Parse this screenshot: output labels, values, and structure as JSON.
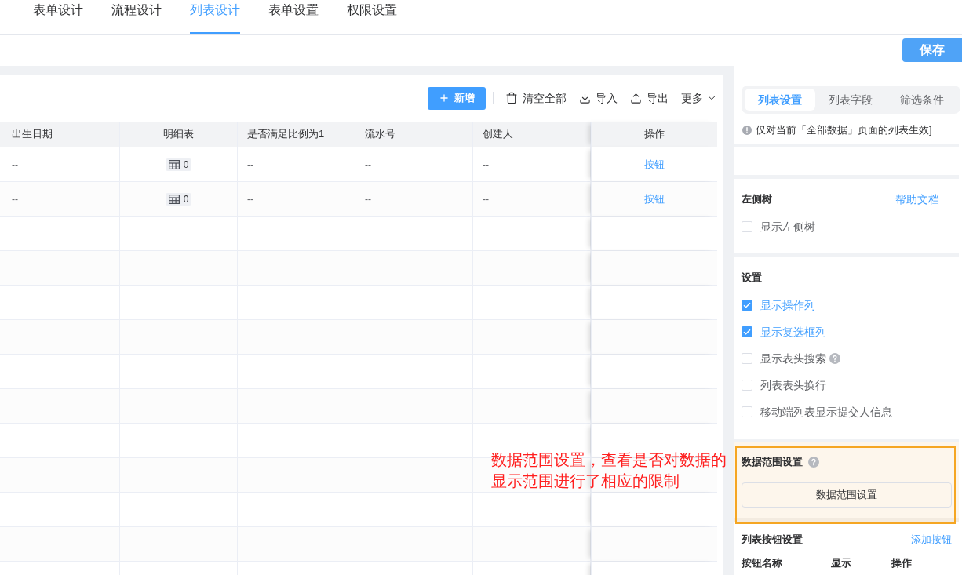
{
  "top_tabs": [
    {
      "label": "表单设计",
      "selected": false
    },
    {
      "label": "流程设计",
      "selected": false
    },
    {
      "label": "列表设计",
      "selected": true
    },
    {
      "label": "表单设置",
      "selected": false
    },
    {
      "label": "权限设置",
      "selected": false
    }
  ],
  "save_button": "保存",
  "table_toolbar": [
    {
      "kind": "add",
      "label": "新增"
    },
    {
      "kind": "clear",
      "label": "清空全部"
    },
    {
      "kind": "import",
      "label": "导入"
    },
    {
      "kind": "export",
      "label": "导出"
    },
    {
      "kind": "more",
      "label": "更多"
    }
  ],
  "table": {
    "columns": [
      {
        "label": "出生日期",
        "kind": "text"
      },
      {
        "label": "明细表",
        "kind": "subtable"
      },
      {
        "label": "是否满足比例为1",
        "kind": "text"
      },
      {
        "label": "流水号",
        "kind": "text"
      },
      {
        "label": "创建人",
        "kind": "text"
      },
      {
        "label": "操作",
        "kind": "action"
      }
    ],
    "rows": [
      {
        "cells": [
          "--",
          "0",
          "--",
          "--",
          "--",
          "按钮"
        ]
      },
      {
        "cells": [
          "--",
          "0",
          "--",
          "--",
          "--",
          "按钮"
        ]
      }
    ]
  },
  "side_panel": {
    "tabs": [
      {
        "label": "列表设置",
        "selected": true
      },
      {
        "label": "列表字段",
        "selected": false
      },
      {
        "label": "筛选条件",
        "selected": false
      }
    ],
    "notice": "仅对当前「全部数据」页面的列表生效]",
    "sections": [
      {
        "kind": "checklist",
        "title": "左侧树",
        "help": false,
        "highlighted": false,
        "link": "帮助文档",
        "items": [
          {
            "label": "显示左侧树",
            "checked": false,
            "help": false
          }
        ]
      },
      {
        "kind": "checklist",
        "title": "设置",
        "help": false,
        "highlighted": false,
        "items": [
          {
            "label": "显示操作列",
            "checked": true,
            "help": false
          },
          {
            "label": "显示复选框列",
            "checked": true,
            "help": false
          },
          {
            "label": "显示表头搜索",
            "checked": false,
            "help": true
          },
          {
            "label": "列表表头换行",
            "checked": false,
            "help": false
          },
          {
            "label": "移动端列表显示提交人信息",
            "checked": false,
            "help": false
          }
        ]
      },
      {
        "kind": "button",
        "title": "数据范围设置",
        "help": true,
        "highlighted": true,
        "button": "数据范围设置"
      },
      {
        "kind": "button_table",
        "title": "列表按钮设置",
        "help": false,
        "highlighted": false,
        "link": "添加按钮",
        "columns": [
          "按钮名称",
          "显示",
          "操作"
        ]
      }
    ]
  },
  "annotation": "数据范围设置，查看是否对数据的显示范围进行了相应的限制"
}
